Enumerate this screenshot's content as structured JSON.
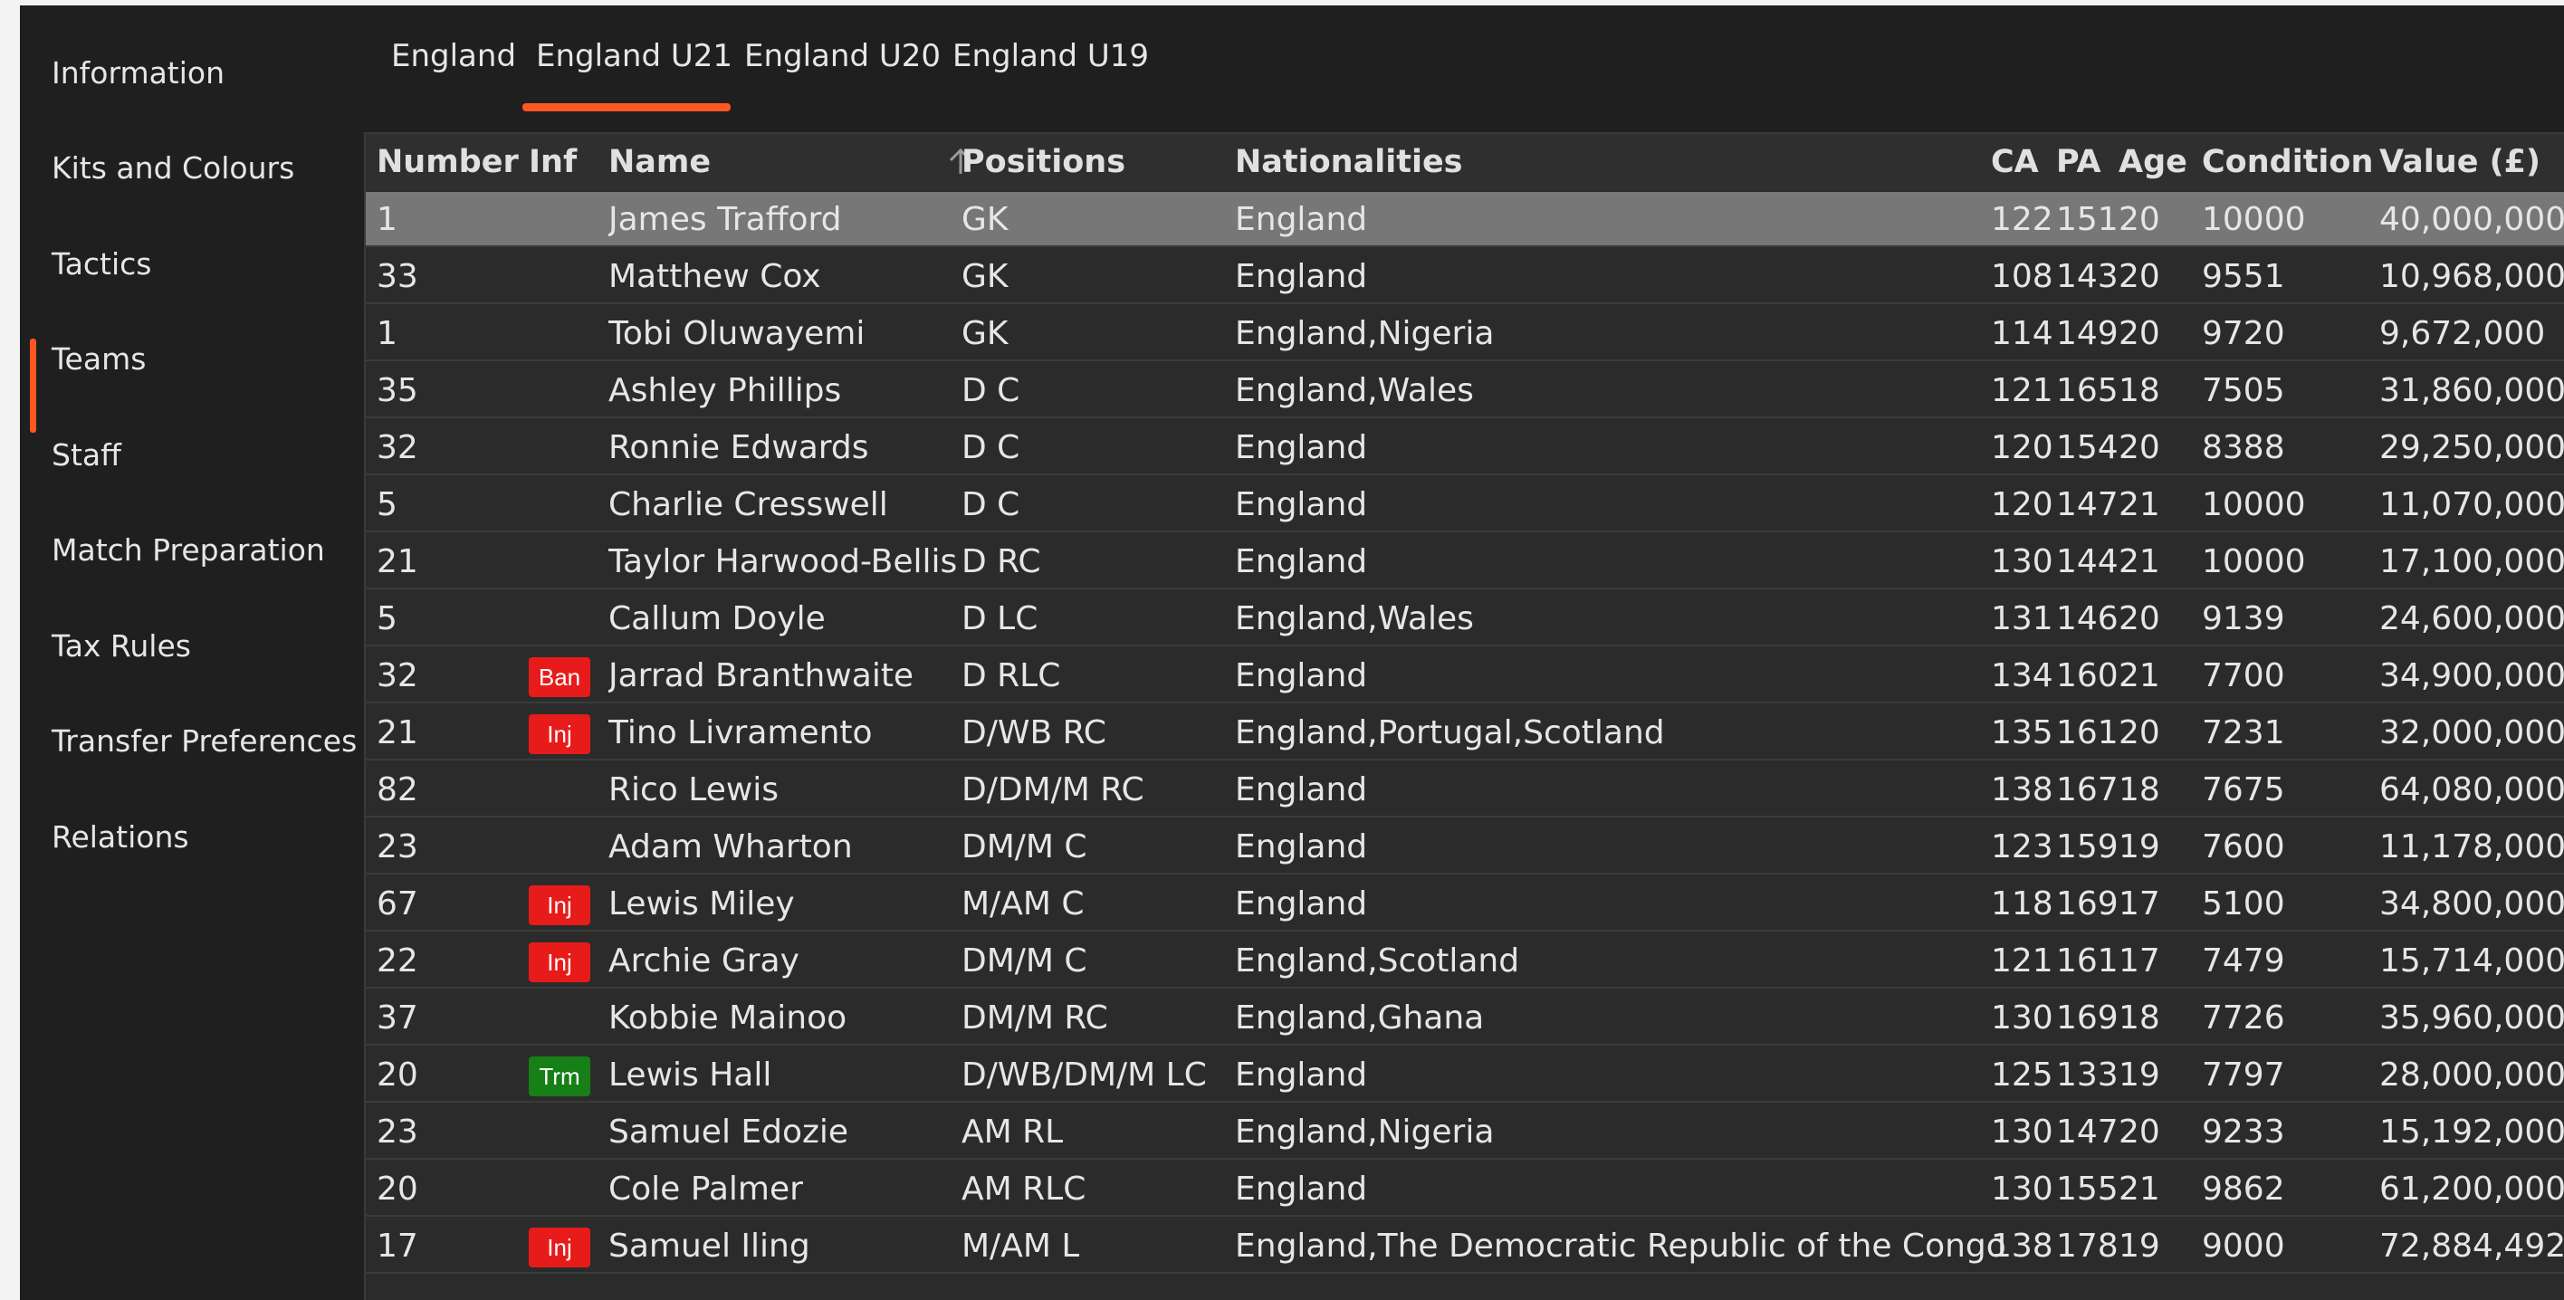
{
  "sidebar": {
    "items": [
      {
        "label": "Information",
        "active": false
      },
      {
        "label": "Kits and Colours",
        "active": false
      },
      {
        "label": "Tactics",
        "active": false
      },
      {
        "label": "Teams",
        "active": true
      },
      {
        "label": "Staff",
        "active": false
      },
      {
        "label": "Match Preparation",
        "active": false
      },
      {
        "label": "Tax Rules",
        "active": false
      },
      {
        "label": "Transfer Preferences",
        "active": false
      },
      {
        "label": "Relations",
        "active": false
      }
    ]
  },
  "tabs": [
    {
      "label": "England",
      "active": false
    },
    {
      "label": "England U21",
      "active": true
    },
    {
      "label": "England U20",
      "active": false
    },
    {
      "label": "England U19",
      "active": false
    }
  ],
  "colors": {
    "accent": "#ff5722",
    "badge_ban": "#e81b1b",
    "badge_inj": "#e81b1b",
    "badge_trm": "#168016",
    "row_selected": "#777777"
  },
  "table": {
    "sort_column": "Name",
    "sort_icon": "arrow-up-icon",
    "columns": [
      "Number",
      "Inf",
      "Name",
      "Positions",
      "Nationalities",
      "CA",
      "PA",
      "Age",
      "Condition",
      "Value (£)"
    ],
    "rows": [
      {
        "number": "1",
        "inf": "",
        "name": "James Trafford",
        "positions": "GK",
        "nationalities": "England",
        "ca": "122",
        "pa": "151",
        "age": "20",
        "condition": "10000",
        "value": "40,000,000",
        "selected": true
      },
      {
        "number": "33",
        "inf": "",
        "name": "Matthew Cox",
        "positions": "GK",
        "nationalities": "England",
        "ca": "108",
        "pa": "143",
        "age": "20",
        "condition": "9551",
        "value": "10,968,000"
      },
      {
        "number": "1",
        "inf": "",
        "name": "Tobi Oluwayemi",
        "positions": "GK",
        "nationalities": "England,Nigeria",
        "ca": "114",
        "pa": "149",
        "age": "20",
        "condition": "9720",
        "value": "9,672,000"
      },
      {
        "number": "35",
        "inf": "",
        "name": "Ashley Phillips",
        "positions": "D C",
        "nationalities": "England,Wales",
        "ca": "121",
        "pa": "165",
        "age": "18",
        "condition": "7505",
        "value": "31,860,000"
      },
      {
        "number": "32",
        "inf": "",
        "name": "Ronnie Edwards",
        "positions": "D C",
        "nationalities": "England",
        "ca": "120",
        "pa": "154",
        "age": "20",
        "condition": "8388",
        "value": "29,250,000"
      },
      {
        "number": "5",
        "inf": "",
        "name": "Charlie Cresswell",
        "positions": "D C",
        "nationalities": "England",
        "ca": "120",
        "pa": "147",
        "age": "21",
        "condition": "10000",
        "value": "11,070,000"
      },
      {
        "number": "21",
        "inf": "",
        "name": "Taylor Harwood-Bellis",
        "positions": "D RC",
        "nationalities": "England",
        "ca": "130",
        "pa": "144",
        "age": "21",
        "condition": "10000",
        "value": "17,100,000"
      },
      {
        "number": "5",
        "inf": "",
        "name": "Callum Doyle",
        "positions": "D LC",
        "nationalities": "England,Wales",
        "ca": "131",
        "pa": "146",
        "age": "20",
        "condition": "9139",
        "value": "24,600,000"
      },
      {
        "number": "32",
        "inf": "Ban",
        "name": "Jarrad Branthwaite",
        "positions": "D RLC",
        "nationalities": "England",
        "ca": "134",
        "pa": "160",
        "age": "21",
        "condition": "7700",
        "value": "34,900,000"
      },
      {
        "number": "21",
        "inf": "Inj",
        "name": "Tino Livramento",
        "positions": "D/WB RC",
        "nationalities": "England,Portugal,Scotland",
        "ca": "135",
        "pa": "161",
        "age": "20",
        "condition": "7231",
        "value": "32,000,000"
      },
      {
        "number": "82",
        "inf": "",
        "name": "Rico Lewis",
        "positions": "D/DM/M RC",
        "nationalities": "England",
        "ca": "138",
        "pa": "167",
        "age": "18",
        "condition": "7675",
        "value": "64,080,000"
      },
      {
        "number": "23",
        "inf": "",
        "name": "Adam Wharton",
        "positions": "DM/M C",
        "nationalities": "England",
        "ca": "123",
        "pa": "159",
        "age": "19",
        "condition": "7600",
        "value": "11,178,000"
      },
      {
        "number": "67",
        "inf": "Inj",
        "name": "Lewis Miley",
        "positions": "M/AM C",
        "nationalities": "England",
        "ca": "118",
        "pa": "169",
        "age": "17",
        "condition": "5100",
        "value": "34,800,000"
      },
      {
        "number": "22",
        "inf": "Inj",
        "name": "Archie Gray",
        "positions": "DM/M C",
        "nationalities": "England,Scotland",
        "ca": "121",
        "pa": "161",
        "age": "17",
        "condition": "7479",
        "value": "15,714,000"
      },
      {
        "number": "37",
        "inf": "",
        "name": "Kobbie Mainoo",
        "positions": "DM/M RC",
        "nationalities": "England,Ghana",
        "ca": "130",
        "pa": "169",
        "age": "18",
        "condition": "7726",
        "value": "35,960,000"
      },
      {
        "number": "20",
        "inf": "Trm",
        "name": "Lewis Hall",
        "positions": "D/WB/DM/M LC",
        "nationalities": "England",
        "ca": "125",
        "pa": "133",
        "age": "19",
        "condition": "7797",
        "value": "28,000,000"
      },
      {
        "number": "23",
        "inf": "",
        "name": "Samuel Edozie",
        "positions": "AM RL",
        "nationalities": "England,Nigeria",
        "ca": "130",
        "pa": "147",
        "age": "20",
        "condition": "9233",
        "value": "15,192,000"
      },
      {
        "number": "20",
        "inf": "",
        "name": "Cole Palmer",
        "positions": "AM RLC",
        "nationalities": "England",
        "ca": "130",
        "pa": "155",
        "age": "21",
        "condition": "9862",
        "value": "61,200,000"
      },
      {
        "number": "17",
        "inf": "Inj",
        "name": "Samuel Iling",
        "positions": "M/AM L",
        "nationalities": "England,The Democratic Republic of the Congo",
        "ca": "138",
        "pa": "178",
        "age": "19",
        "condition": "9000",
        "value": "72,884,492"
      }
    ]
  }
}
